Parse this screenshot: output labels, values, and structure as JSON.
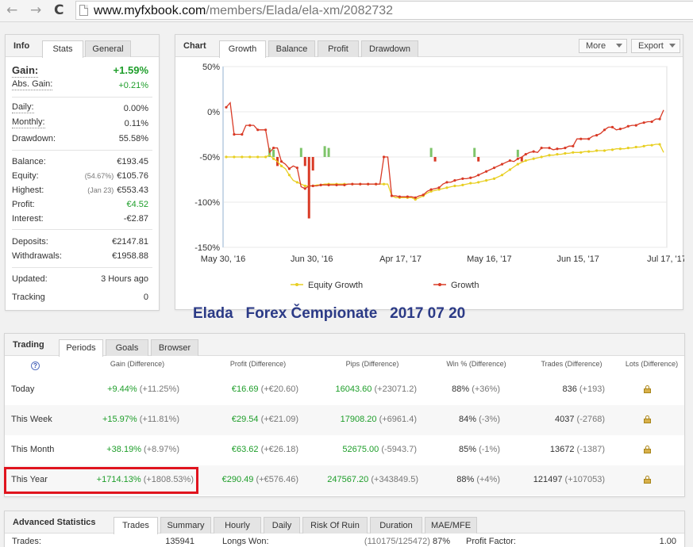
{
  "browser": {
    "back_glyph": "←",
    "forward_glyph": "→",
    "reload_glyph": "C",
    "url_host": "www.myfxbook.com",
    "url_path": "/members/Elada/ela-xm/2082732"
  },
  "info": {
    "title": "Info",
    "tabs": [
      "Stats",
      "General"
    ],
    "gain_label": "Gain:",
    "gain_value": "+1.59%",
    "abs_gain_label": "Abs. Gain:",
    "abs_gain_value": "+0.21%",
    "daily_label": "Daily:",
    "daily_value": "0.00%",
    "monthly_label": "Monthly:",
    "monthly_value": "0.11%",
    "drawdown_label": "Drawdown:",
    "drawdown_value": "55.58%",
    "balance_label": "Balance:",
    "balance_value": "€193.45",
    "equity_label": "Equity:",
    "equity_note": "(54.67%)",
    "equity_value": "€105.76",
    "highest_label": "Highest:",
    "highest_note": "(Jan 23)",
    "highest_value": "€553.43",
    "profit_label": "Profit:",
    "profit_value": "€4.52",
    "interest_label": "Interest:",
    "interest_value": "-€2.87",
    "deposits_label": "Deposits:",
    "deposits_value": "€2147.81",
    "withdrawals_label": "Withdrawals:",
    "withdrawals_value": "€1958.88",
    "updated_label": "Updated:",
    "updated_value": "3 Hours ago",
    "tracking_label": "Tracking",
    "tracking_value": "0"
  },
  "chart_panel": {
    "title": "Chart",
    "tabs": [
      "Growth",
      "Balance",
      "Profit",
      "Drawdown"
    ],
    "more_label": "More",
    "export_label": "Export"
  },
  "chart_data": {
    "type": "line",
    "y_ticks": [
      "50%",
      "0%",
      "-50%",
      "-100%",
      "-150%"
    ],
    "ylim": [
      -150,
      50
    ],
    "x_ticks": [
      "May 30, '16",
      "Jun 30, '16",
      "Apr 17, '17",
      "May 16, '17",
      "Jun 15, '17",
      "Jul 17, '17"
    ],
    "series": [
      {
        "name": "Equity Growth",
        "color": "#e8cf22",
        "values": [
          -50,
          -50,
          -50,
          -50,
          -50,
          -50,
          -50,
          -50,
          -50,
          -50,
          -50,
          -48,
          -52,
          -55,
          -60,
          -63,
          -70,
          -76,
          -78,
          -80,
          -82,
          -82,
          -82,
          -81,
          -81,
          -80,
          -80,
          -80,
          -80,
          -80,
          -80,
          -80,
          -80,
          -80,
          -80,
          -80,
          -80,
          -80,
          -80,
          -80,
          -80,
          -80,
          -93,
          -95,
          -95,
          -95,
          -95,
          -95,
          -97,
          -95,
          -93,
          -90,
          -88,
          -87,
          -86,
          -85,
          -84,
          -83,
          -82,
          -82,
          -81,
          -80,
          -79,
          -79,
          -78,
          -77,
          -76,
          -75,
          -74,
          -72,
          -70,
          -67,
          -64,
          -61,
          -58,
          -56,
          -54,
          -53,
          -52,
          -51,
          -50,
          -49,
          -48,
          -48,
          -47,
          -47,
          -46,
          -46,
          -45,
          -45,
          -45,
          -44,
          -44,
          -44,
          -43,
          -43,
          -43,
          -42,
          -42,
          -41,
          -41,
          -41,
          -40,
          -40,
          -39,
          -39,
          -38,
          -37,
          -37,
          -36,
          -36,
          -45
        ]
      },
      {
        "name": "Growth",
        "color": "#d93a26",
        "values": [
          5,
          10,
          -25,
          -25,
          -25,
          -15,
          -15,
          -15,
          -20,
          -20,
          -20,
          -45,
          -40,
          -40,
          -55,
          -58,
          -63,
          -60,
          -62,
          -83,
          -85,
          -82,
          -82,
          -82,
          -81,
          -81,
          -81,
          -81,
          -81,
          -81,
          -81,
          -80,
          -80,
          -80,
          -80,
          -80,
          -80,
          -80,
          -80,
          -80,
          -50,
          -50,
          -93,
          -93,
          -94,
          -94,
          -94,
          -94,
          -95,
          -93,
          -92,
          -88,
          -86,
          -85,
          -84,
          -80,
          -78,
          -78,
          -76,
          -75,
          -74,
          -74,
          -73,
          -72,
          -70,
          -68,
          -66,
          -64,
          -62,
          -60,
          -58,
          -56,
          -54,
          -55,
          -52,
          -50,
          -47,
          -45,
          -44,
          -45,
          -40,
          -40,
          -40,
          -42,
          -41,
          -41,
          -40,
          -38,
          -38,
          -30,
          -30,
          -30,
          -30,
          -27,
          -26,
          -24,
          -20,
          -17,
          -17,
          -20,
          -19,
          -18,
          -16,
          -15,
          -15,
          -13,
          -12,
          -11,
          -11,
          -8,
          -8,
          2
        ]
      }
    ],
    "bars": [
      0,
      0,
      0,
      0,
      0,
      0,
      0,
      0,
      0,
      0,
      0,
      10,
      8,
      -10,
      0,
      0,
      0,
      0,
      0,
      10,
      -10,
      -68,
      -15,
      0,
      0,
      12,
      10,
      0,
      0,
      0,
      0,
      0,
      0,
      0,
      0,
      0,
      0,
      0,
      0,
      0,
      0,
      0,
      0,
      0,
      0,
      0,
      0,
      0,
      0,
      0,
      0,
      0,
      10,
      -5,
      0,
      0,
      0,
      0,
      0,
      0,
      0,
      0,
      0,
      10,
      -5,
      0,
      0,
      0,
      0,
      0,
      0,
      0,
      0,
      0,
      8,
      -5,
      0,
      0,
      0,
      0,
      0,
      0,
      0,
      0,
      0,
      0,
      0,
      0,
      0,
      0,
      0,
      0,
      0,
      0,
      0,
      0,
      0,
      0,
      0,
      0,
      0,
      0,
      0,
      0,
      0,
      0,
      0,
      0,
      0,
      0,
      0,
      0
    ],
    "bar_color_pos": "#7ec46a",
    "bar_color_neg": "#d93a26"
  },
  "banner": {
    "text": "Elada   Forex Čempionate   2017 07 20",
    "color": "#2b3a86"
  },
  "trading": {
    "title": "Trading",
    "tabs": [
      "Periods",
      "Goals",
      "Browser"
    ],
    "help_glyph": "?",
    "columns": [
      "Gain (Difference)",
      "Profit (Difference)",
      "Pips (Difference)",
      "Win % (Difference)",
      "Trades (Difference)",
      "Lots (Difference)"
    ],
    "rows": [
      {
        "period": "Today",
        "gain": "+9.44%",
        "gain_diff": "(+11.25%)",
        "profit": "€16.69",
        "profit_diff": "(+€20.60)",
        "pips": "16043.60",
        "pips_diff": "(+23071.2)",
        "win": "88%",
        "win_diff": "(+36%)",
        "trades": "836",
        "trades_diff": "(+193)"
      },
      {
        "period": "This Week",
        "gain": "+15.97%",
        "gain_diff": "(+11.81%)",
        "profit": "€29.54",
        "profit_diff": "(+€21.09)",
        "pips": "17908.20",
        "pips_diff": "(+6961.4)",
        "win": "84%",
        "win_diff": "(-3%)",
        "trades": "4037",
        "trades_diff": "(-2768)"
      },
      {
        "period": "This Month",
        "gain": "+38.19%",
        "gain_diff": "(+8.97%)",
        "profit": "€63.62",
        "profit_diff": "(+€26.18)",
        "pips": "52675.00",
        "pips_diff": "(-5943.7)",
        "win": "85%",
        "win_diff": "(-1%)",
        "trades": "13672",
        "trades_diff": "(-1387)"
      },
      {
        "period": "This Year",
        "gain": "+1714.13%",
        "gain_diff": "(+1808.53%)",
        "profit": "€290.49",
        "profit_diff": "(+€576.46)",
        "pips": "247567.20",
        "pips_diff": "(+343849.5)",
        "win": "88%",
        "win_diff": "(+4%)",
        "trades": "121497",
        "trades_diff": "(+107053)"
      }
    ]
  },
  "advanced": {
    "title": "Advanced Statistics",
    "tabs": [
      "Trades",
      "Summary",
      "Hourly",
      "Daily",
      "Risk Of Ruin",
      "Duration",
      "MAE/MFE"
    ],
    "trades_label": "Trades:",
    "trades_value": "135941",
    "longs_label": "Longs Won:",
    "longs_note": "(110175/125472)",
    "longs_value": "87%",
    "pf_label": "Profit Factor:",
    "pf_value": "1.00"
  },
  "colors": {
    "accent_green": "#1e9e2a",
    "highlight_red": "#e0141e",
    "banner_blue": "#2b3a86"
  }
}
